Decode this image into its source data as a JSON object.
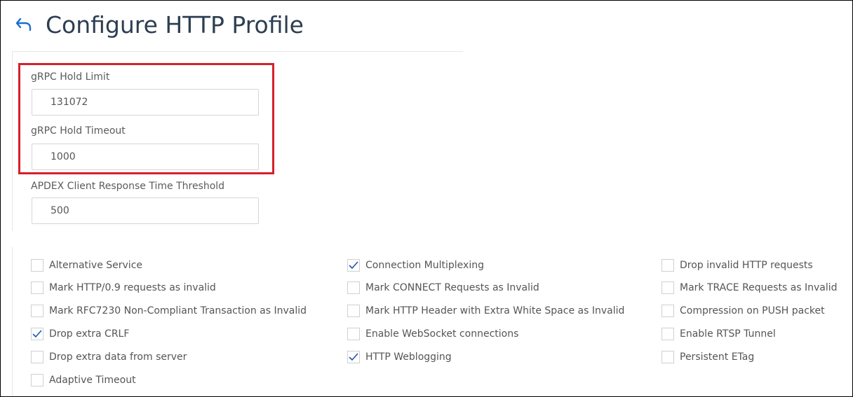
{
  "header": {
    "title": "Configure HTTP Profile"
  },
  "fields": {
    "grpc_hold_limit": {
      "label": "gRPC Hold Limit",
      "value": "131072"
    },
    "grpc_hold_timeout": {
      "label": "gRPC Hold Timeout",
      "value": "1000"
    },
    "apdex": {
      "label": "APDEX Client Response Time Threshold",
      "value": "500"
    }
  },
  "checkboxes": {
    "col1": [
      {
        "label": "Alternative Service",
        "checked": false
      },
      {
        "label": "Mark HTTP/0.9 requests as invalid",
        "checked": false
      },
      {
        "label": "Mark RFC7230 Non-Compliant Transaction as Invalid",
        "checked": false
      },
      {
        "label": "Drop extra CRLF",
        "checked": true
      },
      {
        "label": "Drop extra data from server",
        "checked": false
      },
      {
        "label": "Adaptive Timeout",
        "checked": false
      }
    ],
    "col2": [
      {
        "label": "Connection Multiplexing",
        "checked": true
      },
      {
        "label": "Mark CONNECT Requests as Invalid",
        "checked": false
      },
      {
        "label": "Mark HTTP Header with Extra White Space as Invalid",
        "checked": false
      },
      {
        "label": "Enable WebSocket connections",
        "checked": false
      },
      {
        "label": "HTTP Weblogging",
        "checked": true
      }
    ],
    "col3": [
      {
        "label": "Drop invalid HTTP requests",
        "checked": false
      },
      {
        "label": "Mark TRACE Requests as Invalid",
        "checked": false
      },
      {
        "label": "Compression on PUSH packet",
        "checked": false
      },
      {
        "label": "Enable RTSP Tunnel",
        "checked": false
      },
      {
        "label": "Persistent ETag",
        "checked": false
      }
    ]
  },
  "colors": {
    "title": "#2d3e50",
    "back_arrow": "#1a6fd0",
    "highlight": "#d6202b",
    "check": "#1e5aa8"
  }
}
